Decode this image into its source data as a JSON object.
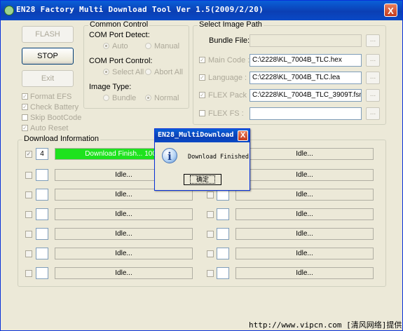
{
  "window": {
    "title": "EN28 Factory Multi Download Tool Ver 1.5(2009/2/20)",
    "close_label": "X"
  },
  "buttons": {
    "flash": "FLASH",
    "stop": "STOP",
    "exit": "Exit"
  },
  "options": [
    {
      "label": "Format EFS",
      "checked": true
    },
    {
      "label": "Check Battery",
      "checked": true
    },
    {
      "label": "Skip BootCode",
      "checked": false
    },
    {
      "label": "Auto Reset",
      "checked": true
    }
  ],
  "common_control": {
    "title": "Common Control",
    "com_detect_label": "COM Port Detect:",
    "com_detect_options": [
      "Auto",
      "Manual"
    ],
    "com_control_label": "COM Port Control:",
    "com_control_options": [
      "Select All",
      "Abort All"
    ],
    "image_type_label": "Image Type:",
    "image_type_options": [
      "Bundle",
      "Normal"
    ]
  },
  "image_path": {
    "title": "Select Image Path",
    "bundle_label": "Bundle File:",
    "bundle_value": "",
    "browse_label": "...",
    "rows": [
      {
        "label": "Main Code :",
        "value": "C:\\2228\\KL_7004B_TLC.hex",
        "checked": true
      },
      {
        "label": "Language :",
        "value": "C:\\2228\\KL_7004B_TLC.lea",
        "checked": true
      },
      {
        "label": "FLEX Pack :",
        "value": "C:\\2228\\KL_7004B_TLC_3909T.fsm",
        "checked": true
      },
      {
        "label": "FLEX FS :",
        "value": "",
        "checked": false
      }
    ]
  },
  "download": {
    "title": "Download Information",
    "active_slot": {
      "number": "4",
      "status": "Download Finish... 100%",
      "progress": 1.0
    },
    "idle_text": "Idle..."
  },
  "dialog": {
    "title": "EN28_MultiDownload",
    "close_label": "X",
    "icon_glyph": "i",
    "message": "Download Finished",
    "ok_label": "确定"
  },
  "watermark": "http://www.vipcn.com [清风网络]提供"
}
